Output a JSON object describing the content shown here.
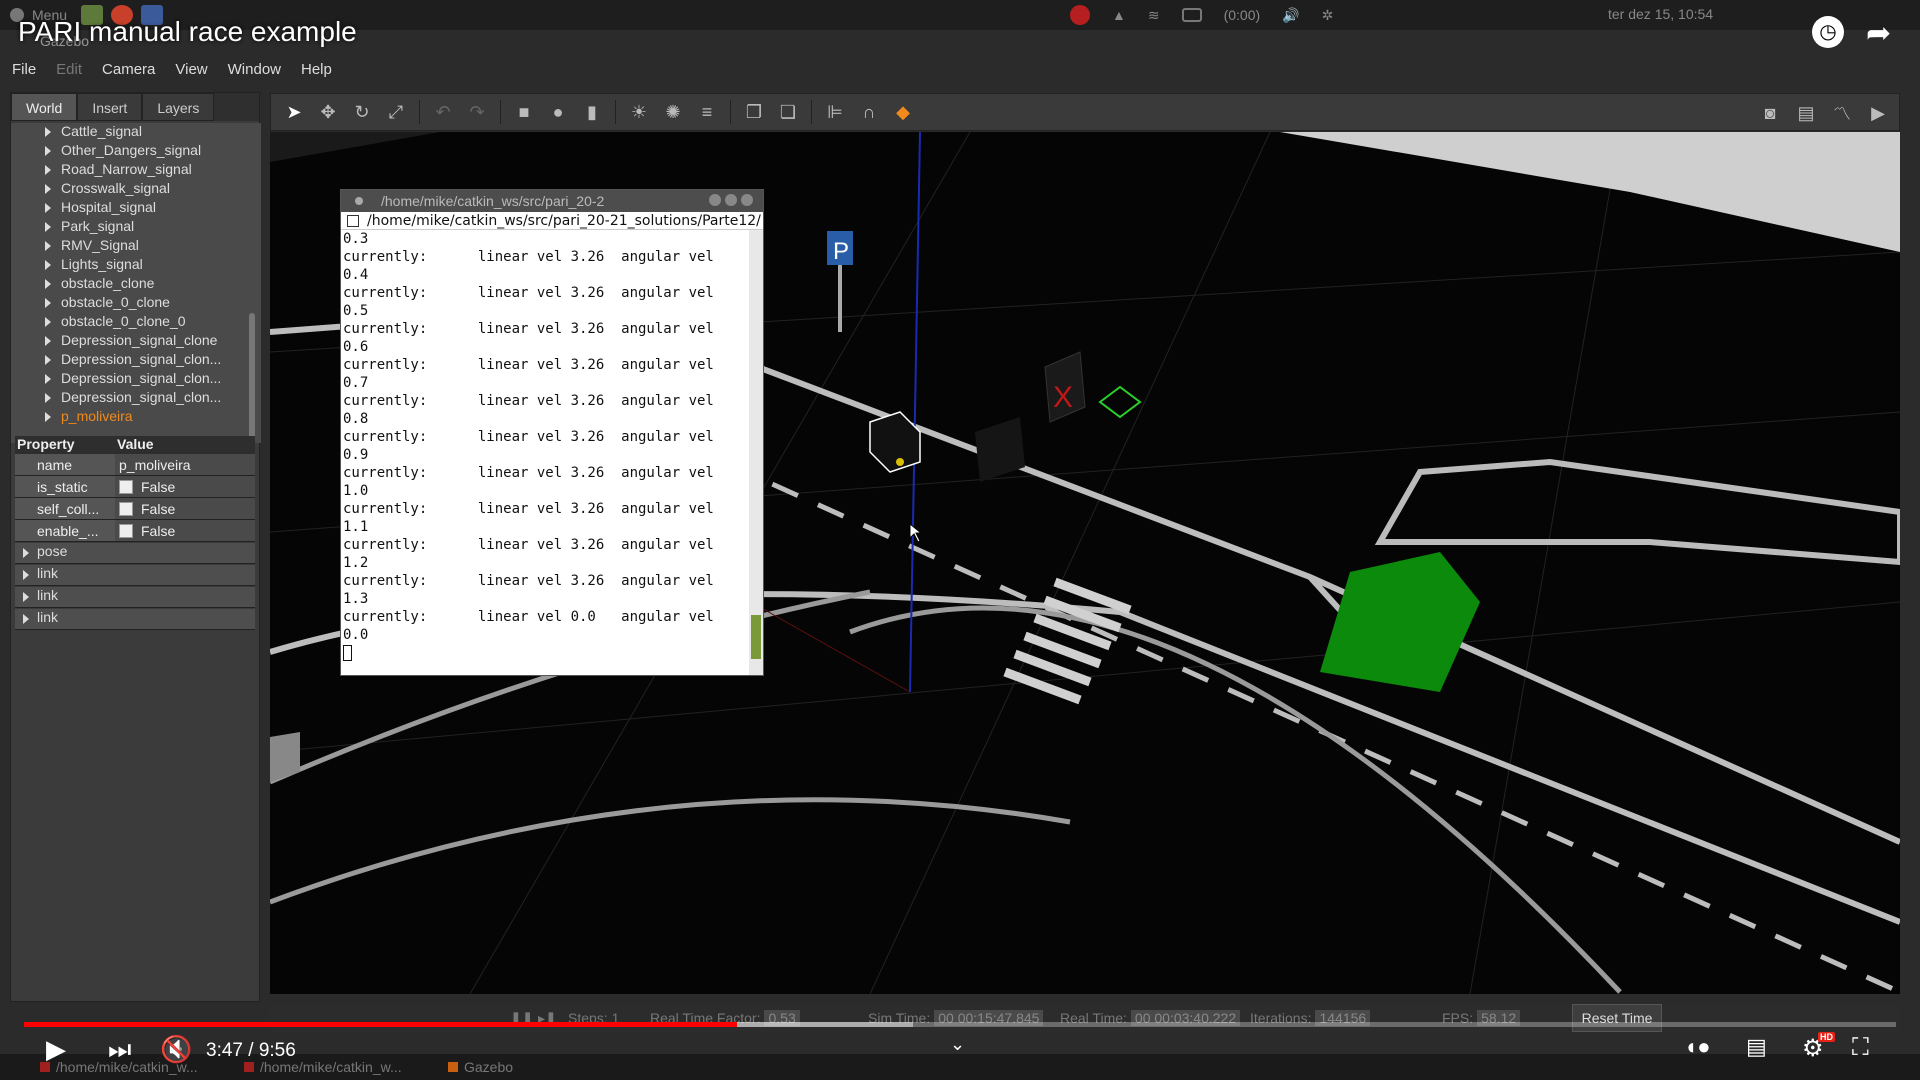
{
  "os_bar": {
    "menu_label": "Menu",
    "datetime": "ter dez 15, 10:54",
    "battery_text": "(0:00)"
  },
  "video": {
    "title": "PARI manual race example",
    "time_display": "3:47 / 9:56",
    "played_fraction": 0.381,
    "loaded_fraction": 0.475
  },
  "gazebo": {
    "window_title": "Gazebo",
    "menu": [
      "File",
      "Edit",
      "Camera",
      "View",
      "Window",
      "Help"
    ],
    "tabs": [
      "World",
      "Insert",
      "Layers"
    ],
    "active_tab": "World",
    "tree_items": [
      "Cattle_signal",
      "Other_Dangers_signal",
      "Road_Narrow_signal",
      "Crosswalk_signal",
      "Hospital_signal",
      "Park_signal",
      "RMV_Signal",
      "Lights_signal",
      "obstacle_clone",
      "obstacle_0_clone",
      "obstacle_0_clone_0",
      "Depression_signal_clone",
      "Depression_signal_clon...",
      "Depression_signal_clon...",
      "Depression_signal_clon...",
      "p_moliveira"
    ],
    "selected_item": "p_moliveira",
    "property_header": {
      "property": "Property",
      "value": "Value"
    },
    "properties": [
      {
        "key": "name",
        "value": "p_moliveira",
        "checkbox": false
      },
      {
        "key": "is_static",
        "value": "False",
        "checkbox": true
      },
      {
        "key": "self_coll...",
        "value": "False",
        "checkbox": true
      },
      {
        "key": "enable_...",
        "value": "False",
        "checkbox": true
      }
    ],
    "property_groups": [
      "pose",
      "link",
      "link",
      "link"
    ],
    "status": {
      "steps_label": "Steps:",
      "steps_value": "1",
      "rtf_label": "Real Time Factor:",
      "rtf_value": "0.53",
      "sim_time_label": "Sim Time:",
      "sim_time_value": "00 00:15:47.845",
      "real_time_label": "Real Time:",
      "real_time_value": "00 00:03:40.222",
      "iterations_label": "Iterations:",
      "iterations_value": "144156",
      "fps_label": "FPS:",
      "fps_value": "58.12",
      "reset_label": "Reset Time"
    }
  },
  "terminal": {
    "title": "/home/mike/catkin_ws/src/pari_20-2",
    "path": "/home/mike/catkin_ws/src/pari_20-21_solutions/Parte12/",
    "lines": [
      "0.3",
      "currently:      linear vel 3.26  angular vel",
      "0.4",
      "currently:      linear vel 3.26  angular vel",
      "0.5",
      "currently:      linear vel 3.26  angular vel",
      "0.6",
      "currently:      linear vel 3.26  angular vel",
      "0.7",
      "currently:      linear vel 3.26  angular vel",
      "0.8",
      "currently:      linear vel 3.26  angular vel",
      "0.9",
      "currently:      linear vel 3.26  angular vel",
      "1.0",
      "currently:      linear vel 3.26  angular vel",
      "1.1",
      "currently:      linear vel 3.26  angular vel",
      "1.2",
      "currently:      linear vel 3.26  angular vel",
      "1.3",
      "currently:      linear vel 0.0   angular vel",
      "0.0"
    ]
  },
  "taskbar": {
    "items": [
      "/home/mike/catkin_w...",
      "/home/mike/catkin_w...",
      "Gazebo"
    ]
  },
  "colors": {
    "accent_selected": "#f08a1c",
    "progress_red": "#ff0000",
    "hd_badge": "#e62117"
  },
  "icons": [
    "menu-icon",
    "folder-icon",
    "chrome-icon",
    "record-icon",
    "wifi-icon",
    "battery-icon",
    "volume-icon",
    "settings-icon",
    "clock-icon",
    "share-icon",
    "play-icon",
    "next-icon",
    "mute-icon",
    "subtitles-icon",
    "gear-icon",
    "fullscreen-exit-icon"
  ]
}
